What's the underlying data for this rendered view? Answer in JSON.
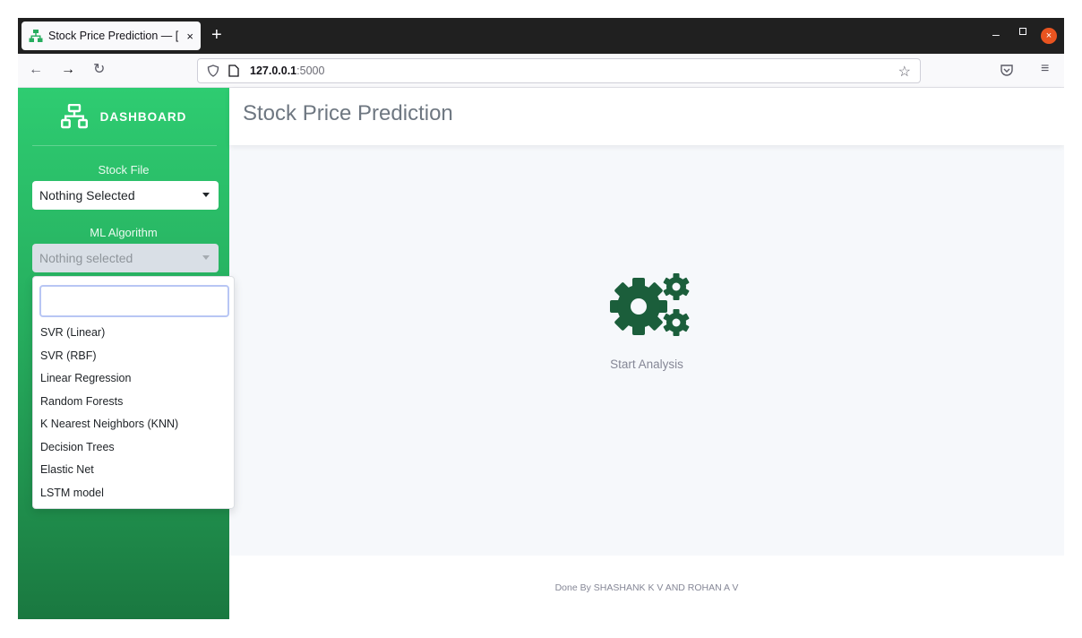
{
  "browser": {
    "tab_title": "Stock Price Prediction — [",
    "tab_close": "×",
    "new_tab": "+",
    "url_host": "127.0.0.1",
    "url_port": ":5000",
    "window_min": "–",
    "window_close": "×"
  },
  "sidebar": {
    "brand": "DASHBOARD",
    "stock_label": "Stock File",
    "stock_value": "Nothing Selected",
    "algo_label": "ML Algorithm",
    "algo_value": "Nothing selected",
    "algo_options": [
      "SVR (Linear)",
      "SVR (RBF)",
      "Linear Regression",
      "Random Forests",
      "K Nearest Neighbors (KNN)",
      "Decision Trees",
      "Elastic Net",
      "LSTM model"
    ]
  },
  "header": {
    "title": "Stock Price Prediction"
  },
  "main": {
    "start_label": "Start Analysis"
  },
  "footer": {
    "text": "Done By SHASHANK K V AND ROHAN A V"
  },
  "colors": {
    "sidebar_green": "#2ecc71",
    "gear_green": "#1b5e3b",
    "close_orange": "#e95420"
  }
}
